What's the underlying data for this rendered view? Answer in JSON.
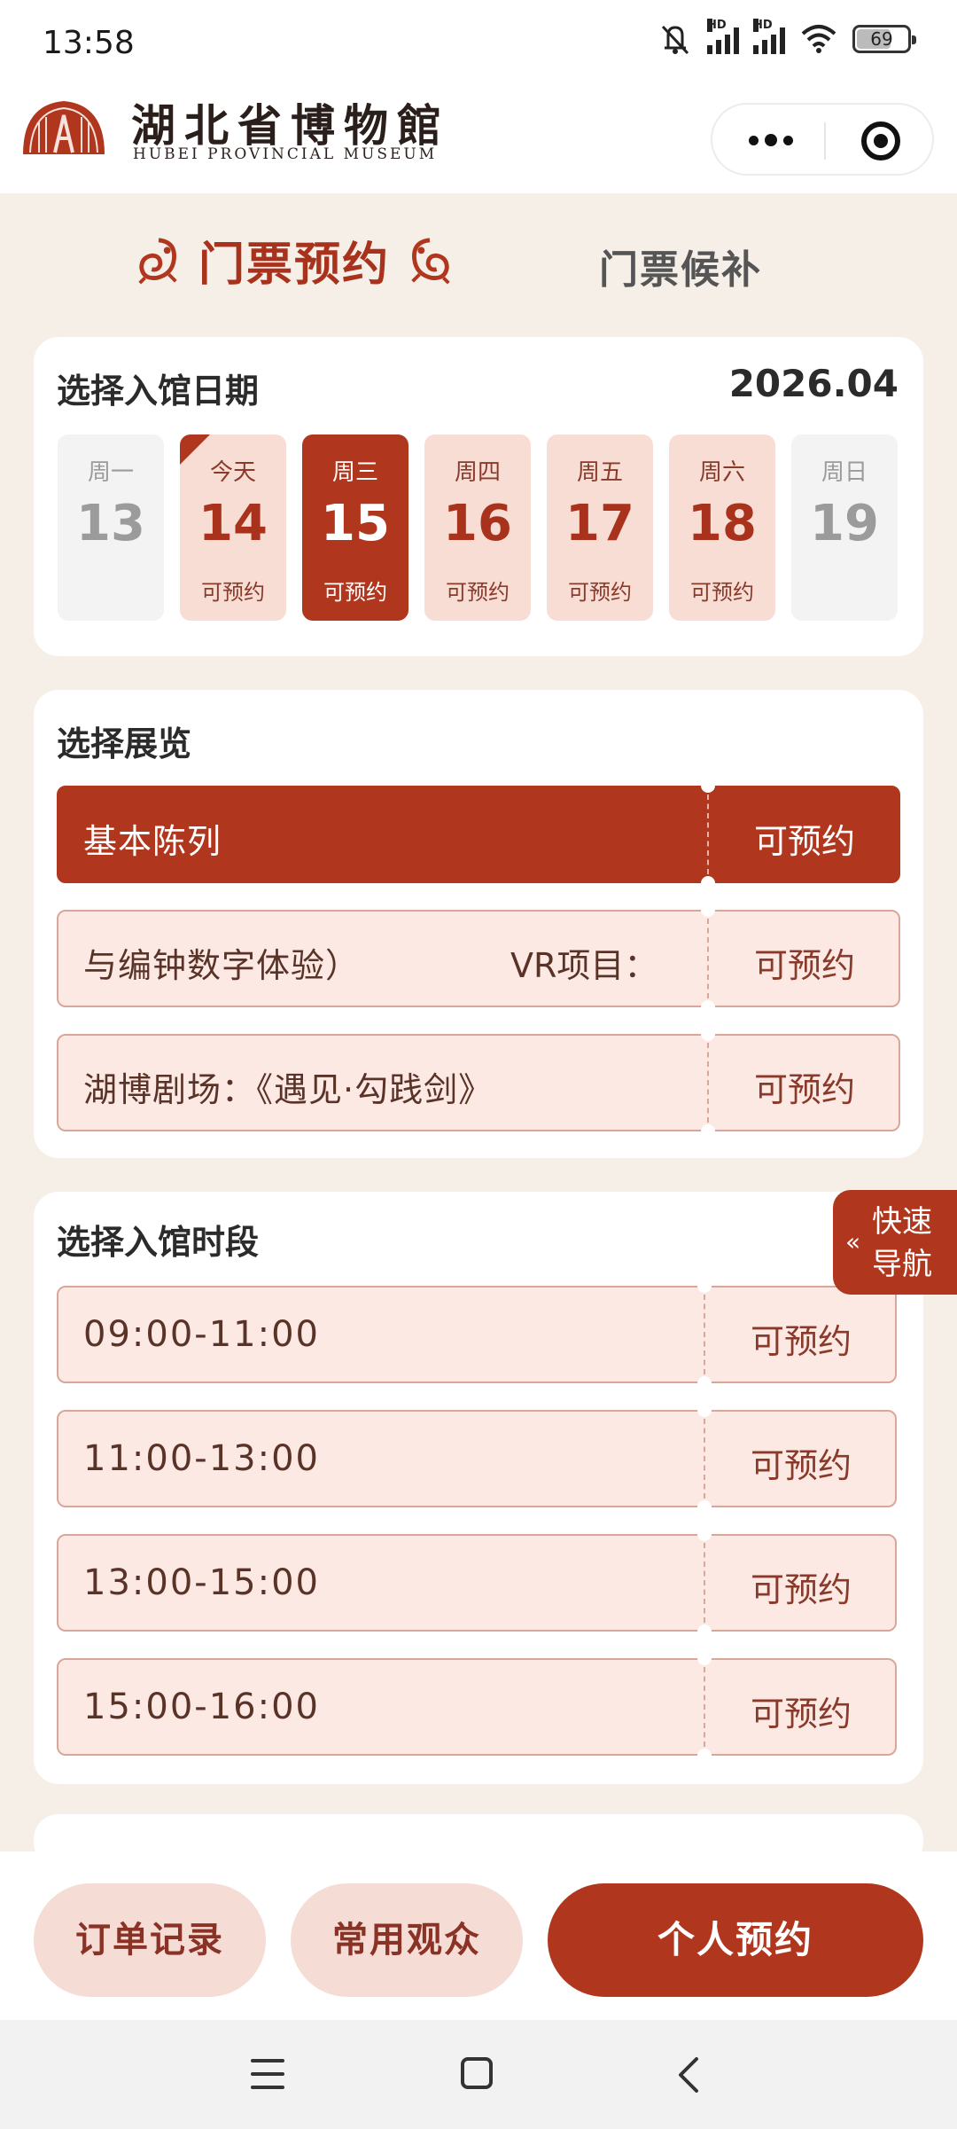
{
  "status_bar": {
    "time": "13:58",
    "network_label_1": "HD",
    "network_label_2": "HD",
    "battery": "69",
    "icons": [
      "mute-icon",
      "signal-icon",
      "signal-icon",
      "wifi-icon",
      "battery-icon"
    ]
  },
  "header": {
    "museum_name_cn": "湖北省博物館",
    "museum_name_en": "HUBEI PROVINCIAL MUSEUM"
  },
  "tabs": {
    "active": "门票预约",
    "inactive": "门票候补"
  },
  "date_section": {
    "title": "选择入馆日期",
    "month": "2026.04",
    "days": [
      {
        "weekday": "周一",
        "date": "13",
        "status": "",
        "state": "disabled"
      },
      {
        "weekday": "今天",
        "date": "14",
        "status": "可预约",
        "state": "available"
      },
      {
        "weekday": "周三",
        "date": "15",
        "status": "可预约",
        "state": "selected"
      },
      {
        "weekday": "周四",
        "date": "16",
        "status": "可预约",
        "state": "available"
      },
      {
        "weekday": "周五",
        "date": "17",
        "status": "可预约",
        "state": "available"
      },
      {
        "weekday": "周六",
        "date": "18",
        "status": "可预约",
        "state": "available"
      },
      {
        "weekday": "周日",
        "date": "19",
        "status": "",
        "state": "disabled"
      }
    ]
  },
  "exhibition_section": {
    "title": "选择展览",
    "items": [
      {
        "name": "基本陈列",
        "name_extra": "",
        "status": "可预约",
        "selected": true
      },
      {
        "name": "与编钟数字体验）",
        "name_extra": "VR项目：",
        "status": "可预约",
        "selected": false
      },
      {
        "name": "湖博剧场：《遇见·勾践剑》",
        "name_extra": "",
        "status": "可预约",
        "selected": false
      }
    ]
  },
  "time_section": {
    "title": "选择入馆时段",
    "slots": [
      {
        "time": "09:00-11:00",
        "status": "可预约"
      },
      {
        "time": "11:00-13:00",
        "status": "可预约"
      },
      {
        "time": "13:00-15:00",
        "status": "可预约"
      },
      {
        "time": "15:00-16:00",
        "status": "可预约"
      }
    ]
  },
  "quick_nav": {
    "chevron": "«",
    "label": "快速导航"
  },
  "bottom_actions": {
    "orders": "订单记录",
    "visitors": "常用观众",
    "book": "个人预约"
  },
  "colors": {
    "primary": "#b1361e",
    "light": "#f8ddd5",
    "background": "#f6efe8"
  }
}
